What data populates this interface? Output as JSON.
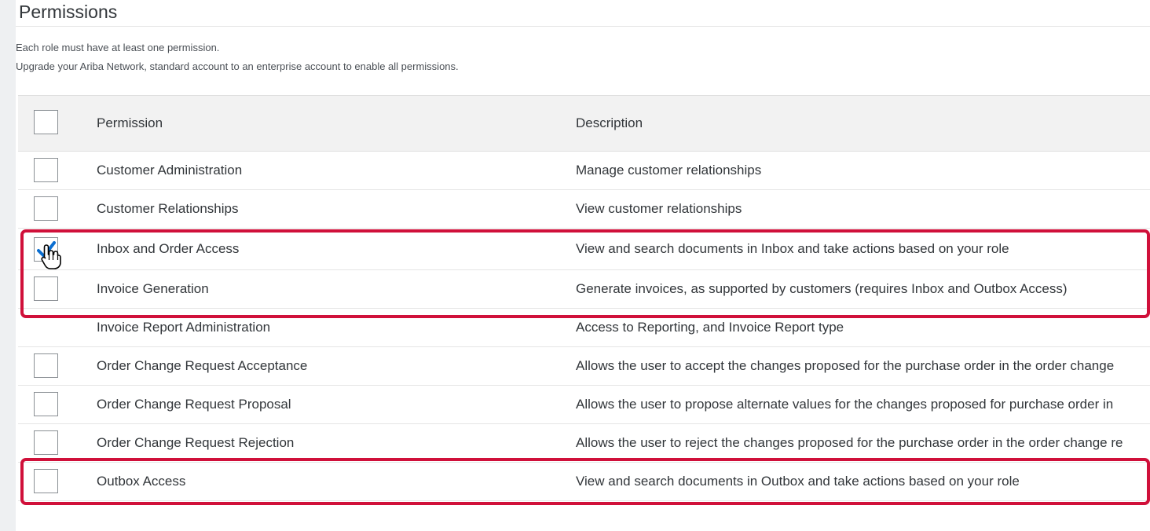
{
  "section": {
    "title": "Permissions",
    "info_lines": [
      "Each role must have at least one permission.",
      "Upgrade your Ariba Network, standard account to an enterprise account to enable all permissions."
    ]
  },
  "table": {
    "columns": [
      "Permission",
      "Description"
    ],
    "rows": [
      {
        "permission": "Customer Administration",
        "description": "Manage customer relationships",
        "checked": false,
        "has_checkbox": true
      },
      {
        "permission": "Customer Relationships",
        "description": "View customer relationships",
        "checked": false,
        "has_checkbox": true
      },
      {
        "permission": "Inbox and Order Access",
        "description": "View and search documents in Inbox and take actions based on your role",
        "checked": true,
        "has_checkbox": true
      },
      {
        "permission": "Invoice Generation",
        "description": "Generate invoices, as supported by customers (requires Inbox and Outbox Access)",
        "checked": false,
        "has_checkbox": true
      },
      {
        "permission": "Invoice Report Administration",
        "description": "Access to Reporting, and Invoice Report type",
        "checked": false,
        "has_checkbox": false
      },
      {
        "permission": "Order Change Request Acceptance",
        "description": "Allows the user to accept the changes proposed for the purchase order in the order change",
        "checked": false,
        "has_checkbox": true
      },
      {
        "permission": "Order Change Request Proposal",
        "description": "Allows the user to propose alternate values for the changes proposed for purchase order in",
        "checked": false,
        "has_checkbox": true
      },
      {
        "permission": "Order Change Request Rejection",
        "description": "Allows the user to reject the changes proposed for the purchase order in the order change re",
        "checked": false,
        "has_checkbox": true
      },
      {
        "permission": "Outbox Access",
        "description": "View and search documents in Outbox and take actions based on your role",
        "checked": false,
        "has_checkbox": true
      }
    ]
  },
  "colors": {
    "highlight": "#d0103a",
    "checkmark": "#0a6ed1",
    "header_bg": "#f2f2f2"
  },
  "icons": {
    "checkmark": "checkmark-icon",
    "cursor": "hand-pointer-icon"
  }
}
